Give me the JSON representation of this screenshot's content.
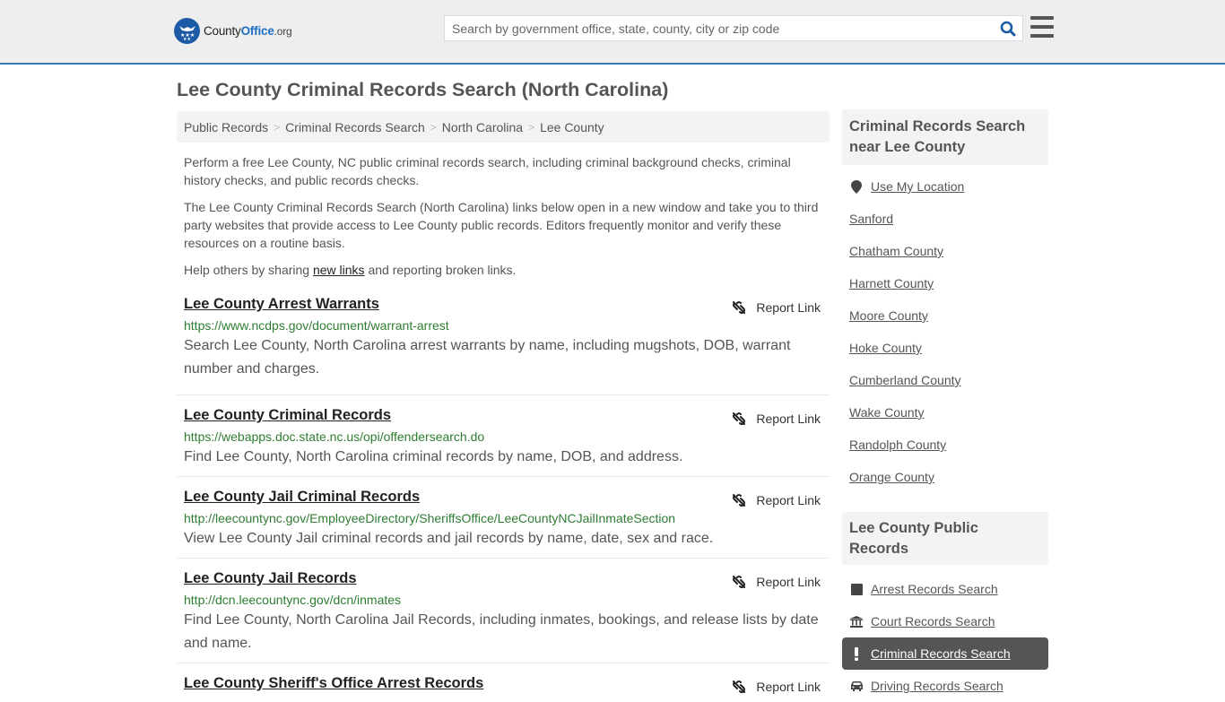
{
  "header": {
    "logo_county": "County",
    "logo_office": "Office",
    "logo_org": ".org",
    "search_placeholder": "Search by government office, state, county, city or zip code",
    "search_icon": "search-icon",
    "menu_icon": "hamburger-menu-icon"
  },
  "page": {
    "title": "Lee County Criminal Records Search (North Carolina)"
  },
  "breadcrumb": [
    {
      "label": "Public Records"
    },
    {
      "label": "Criminal Records Search"
    },
    {
      "label": "North Carolina"
    },
    {
      "label": "Lee County"
    }
  ],
  "breadcrumb_separator": ">",
  "intro": {
    "p1": "Perform a free Lee County, NC public criminal records search, including criminal background checks, criminal history checks, and public records checks.",
    "p2": "The Lee County Criminal Records Search (North Carolina) links below open in a new window and take you to third party websites that provide access to Lee County public records. Editors frequently monitor and verify these resources on a routine basis.",
    "p3_before": "Help others by sharing ",
    "p3_link": "new links",
    "p3_after": " and reporting broken links."
  },
  "report_label": "Report Link",
  "results": [
    {
      "title": "Lee County Arrest Warrants",
      "url": "https://www.ncdps.gov/document/warrant-arrest",
      "desc": "Search Lee County, North Carolina arrest warrants by name, including mugshots, DOB, warrant number and charges."
    },
    {
      "title": "Lee County Criminal Records",
      "url": "https://webapps.doc.state.nc.us/opi/offendersearch.do",
      "desc": "Find Lee County, North Carolina criminal records by name, DOB, and address."
    },
    {
      "title": "Lee County Jail Criminal Records",
      "url": "http://leecountync.gov/EmployeeDirectory/SheriffsOffice/LeeCountyNCJailInmateSection",
      "desc": "View Lee County Jail criminal records and jail records by name, date, sex and race."
    },
    {
      "title": "Lee County Jail Records",
      "url": "http://dcn.leecountync.gov/dcn/inmates",
      "desc": "Find Lee County, North Carolina Jail Records, including inmates, bookings, and release lists by date and name."
    },
    {
      "title": "Lee County Sheriff's Office Arrest Records",
      "url": "",
      "desc": ""
    }
  ],
  "sidebar": {
    "nearby_heading": "Criminal Records Search near Lee County",
    "use_location": "Use My Location",
    "nearby": [
      "Sanford",
      "Chatham County",
      "Harnett County",
      "Moore County",
      "Hoke County",
      "Cumberland County",
      "Wake County",
      "Randolph County",
      "Orange County"
    ],
    "public_heading": "Lee County Public Records",
    "public_records": [
      {
        "label": "Arrest Records Search",
        "icon": "square-icon",
        "active": false
      },
      {
        "label": "Court Records Search",
        "icon": "courthouse-icon",
        "active": false
      },
      {
        "label": "Criminal Records Search",
        "icon": "exclamation-icon",
        "active": true
      },
      {
        "label": "Driving Records Search",
        "icon": "car-icon",
        "active": false
      }
    ]
  },
  "colors": {
    "accent_border": "#337ab7",
    "url_green": "#2e7d32",
    "logo_blue": "#1c5aa6",
    "active_item_bg": "#555555"
  }
}
